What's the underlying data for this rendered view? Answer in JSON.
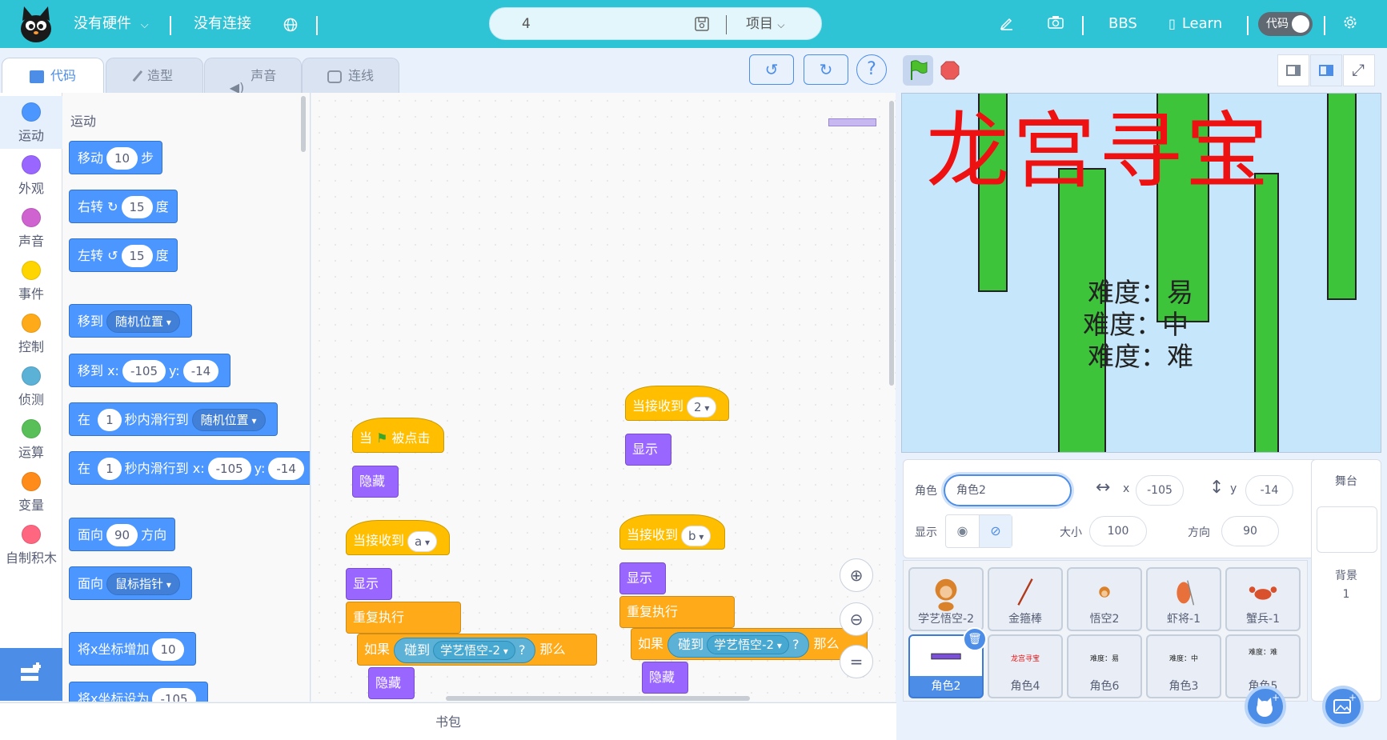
{
  "topbar": {
    "hardware_label": "没有硬件",
    "connection_label": "没有连接",
    "project_name": "4",
    "project_menu_label": "项目",
    "bbs_label": "BBS",
    "learn_label": "Learn",
    "code_toggle_label": "代码",
    "bg_color": "#2ec4d6"
  },
  "tabs": [
    {
      "label": "代码"
    },
    {
      "label": "造型"
    },
    {
      "label": "声音"
    },
    {
      "label": "连线"
    }
  ],
  "categories": [
    {
      "label": "运动",
      "color": "#4c97ff"
    },
    {
      "label": "外观",
      "color": "#9966ff"
    },
    {
      "label": "声音",
      "color": "#cf63cf"
    },
    {
      "label": "事件",
      "color": "#ffd500"
    },
    {
      "label": "控制",
      "color": "#ffab19"
    },
    {
      "label": "侦测",
      "color": "#5cb1d6"
    },
    {
      "label": "运算",
      "color": "#59c059"
    },
    {
      "label": "变量",
      "color": "#ff8c1a"
    },
    {
      "label": "自制积木",
      "color": "#ff6680"
    }
  ],
  "palette": {
    "section_title": "运动",
    "move_label": "移动",
    "move_steps": "10",
    "move_unit": "步",
    "turn_right_label": "右转",
    "turn_right_value": "15",
    "deg_unit": "度",
    "turn_left_label": "左转",
    "turn_left_value": "15",
    "goto_label": "移到",
    "goto_target": "随机位置",
    "goto_xy_label": "移到 x:",
    "goto_x": "-105",
    "y_label": "y:",
    "goto_y": "-14",
    "glide_in_label": "在",
    "glide_secs": "1",
    "glide_to_label": "秒内滑行到",
    "glide_target": "随机位置",
    "glide_xy_label": "秒内滑行到 x:",
    "glide_x": "-105",
    "glide_y": "-14",
    "point_dir_label": "面向",
    "point_dir_value": "90",
    "point_dir_unit": "方向",
    "point_towards_label": "面向",
    "point_towards_target": "鼠标指针",
    "change_x_label": "将x坐标增加",
    "change_x_value": "10",
    "set_x_label": "将x坐标设为",
    "set_x_value": "-105"
  },
  "script": {
    "when_flag_prefix": "当",
    "when_flag_suffix": "被点击",
    "hide_label": "隐藏",
    "show_label": "显示",
    "when_receive_label": "当接收到",
    "msg_2": "2",
    "msg_a": "a",
    "msg_b": "b",
    "forever_label": "重复执行",
    "if_label": "如果",
    "touching_label": "碰到",
    "touch_target": "学艺悟空-2",
    "question": "?",
    "then_label": "那么",
    "then_label_clipped": "那么"
  },
  "backpack_label": "书包",
  "stage": {
    "title_text": "龙宫寻宝",
    "difficulty_lines": [
      "难度：易",
      "难度：中",
      "难度：难"
    ]
  },
  "sprite_info": {
    "sprite_label": "角色",
    "sprite_name": "角色2",
    "x_label": "x",
    "x_value": "-105",
    "y_label": "y",
    "y_value": "-14",
    "show_label": "显示",
    "size_label": "大小",
    "size_value": "100",
    "direction_label": "方向",
    "direction_value": "90"
  },
  "sprites": [
    {
      "name": "学艺悟空-2"
    },
    {
      "name": "金箍棒"
    },
    {
      "name": "悟空2"
    },
    {
      "name": "虾将-1"
    },
    {
      "name": "蟹兵-1"
    },
    {
      "name": "角色2"
    },
    {
      "name": "角色4"
    },
    {
      "name": "角色6"
    },
    {
      "name": "角色3"
    },
    {
      "name": "角色5"
    }
  ],
  "sprite_thumbs": {
    "title_thumb_text": "龙宫寻宝",
    "easy_thumb_text": "难度：易",
    "medium_thumb_text": "难度：中",
    "hard_thumb_text": "难度：难"
  },
  "stage_panel": {
    "title": "舞台",
    "backdrop_label": "背景",
    "backdrop_count": "1"
  }
}
